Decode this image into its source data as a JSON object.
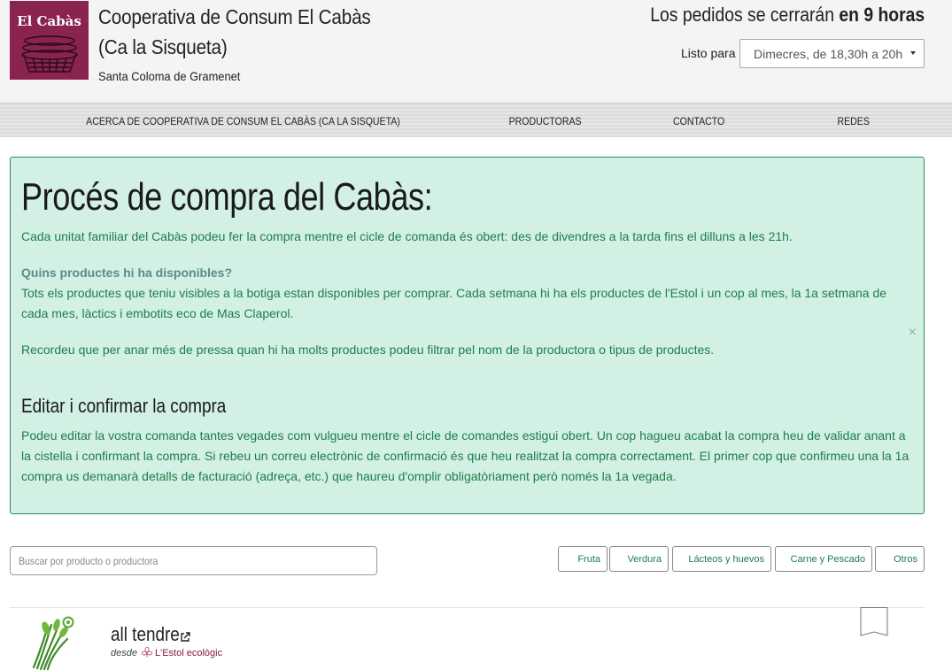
{
  "header": {
    "logo_text": "El Cabàs",
    "shop_name": "Cooperativa de Consum El Cabàs (Ca la Sisqueta)",
    "location": "Santa Coloma de Gramenet",
    "closing_prefix": "Los pedidos se cerrarán",
    "closing_bold": "en 9 horas",
    "ready_label": "Listo para",
    "ready_value": "Dimecres, de 18,30h a 20h"
  },
  "nav": {
    "items": [
      {
        "label": "ACERCA DE COOPERATIVA DE CONSUM EL CABÀS (CA LA SISQUETA)"
      },
      {
        "label": "PRODUCTORAS"
      },
      {
        "label": "CONTACTO"
      },
      {
        "label": "REDES"
      }
    ]
  },
  "info": {
    "title": "Procés de compra del Cabàs:",
    "p1": "Cada unitat familiar del Cabàs podeu fer la compra mentre el cicle de comanda és obert: des de divendres a la tarda fins el dilluns a les 21h.",
    "question": "Quins productes hi ha disponibles?",
    "p2": "Tots els productes que teniu visibles a la botiga estan disponibles per comprar. Cada setmana hi ha els productes de l'Estol i un cop al mes, la 1a setmana de cada mes, làctics i embotits eco de Mas Claperol.",
    "p3": "Recordeu que per anar més de pressa quan hi ha molts productes podeu filtrar pel nom de la productora o tipus de productes.",
    "subtitle": "Editar i confirmar la compra",
    "p4": "Podeu editar la vostra comanda tantes vegades com vulgueu mentre el cicle de comandes estigui obert. Un cop hagueu acabat la compra heu de validar anant a la cistella i confirmant la compra. Si rebeu un correu electrònic de confirmació és que heu realitzat la compra correctament. El primer cop que confirmeu una la 1a compra us demanarà detalls de facturació (adreça, etc.) que haureu d'omplir obligatòriament però només la 1a vegada.",
    "close_glyph": "×"
  },
  "search": {
    "placeholder": "Buscar por producto o productora"
  },
  "filters": [
    {
      "label": "Fruta"
    },
    {
      "label": "Verdura"
    },
    {
      "label": "Lácteos y huevos"
    },
    {
      "label": "Carne y Pescado"
    },
    {
      "label": "Otros"
    }
  ],
  "product": {
    "name": "all tendre",
    "from_label": "desde",
    "producer": "L'Estol ecològic"
  },
  "colors": {
    "logo_bg": "#8a2350",
    "info_bg": "#d2f0e4",
    "info_text": "#1e7d4e",
    "producer_link": "#8a1a3a"
  },
  "icons": [
    "basket-icon",
    "caret-down-icon",
    "close-icon",
    "external-link-icon",
    "flower-icon",
    "bookmark-icon"
  ]
}
